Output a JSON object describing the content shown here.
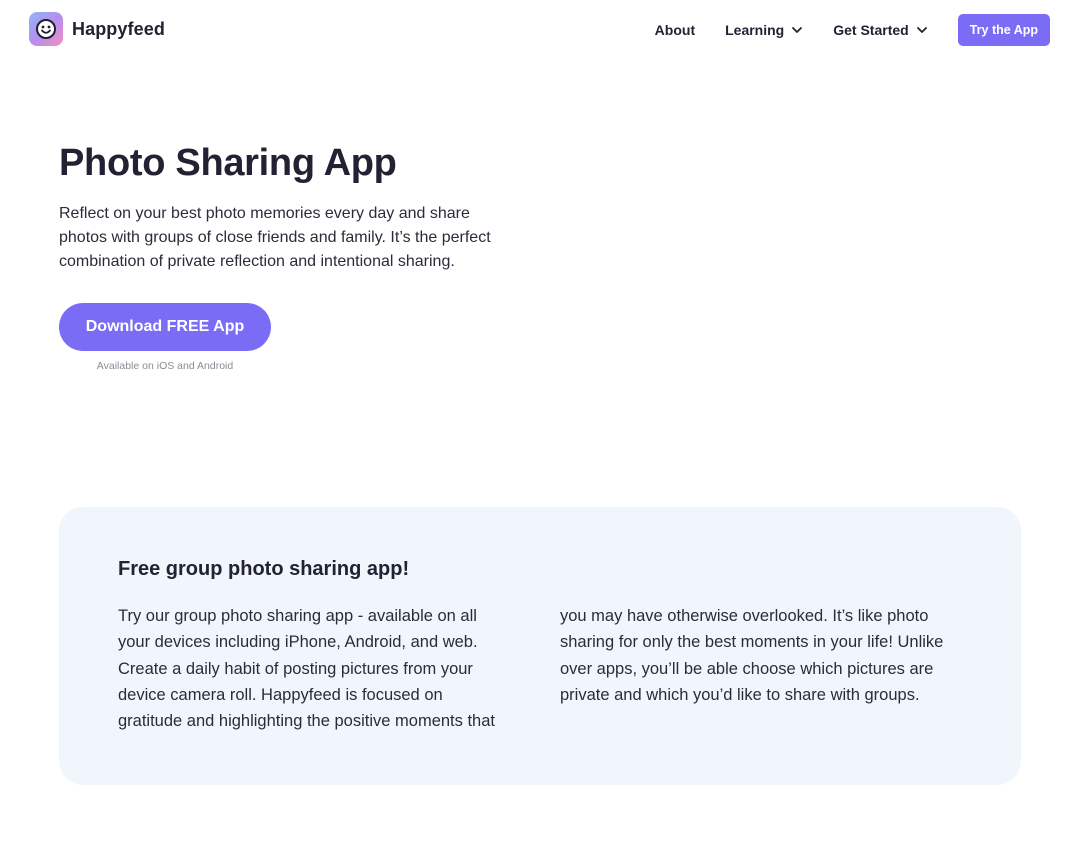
{
  "nav": {
    "brand": "Happyfeed",
    "links": [
      {
        "label": "About",
        "dropdown": false
      },
      {
        "label": "Learning",
        "dropdown": true
      },
      {
        "label": "Get Started",
        "dropdown": true
      }
    ],
    "cta": "Try the App"
  },
  "hero": {
    "title": "Photo Sharing App",
    "description": "Reflect on your best photo memories every day and share photos with groups of close friends and family. It’s the perfect combination of private reflection and intentional sharing.",
    "button": "Download FREE App",
    "note": "Available on iOS and Android"
  },
  "feature": {
    "title": "Free group photo sharing app!",
    "text": "Try our group photo sharing app - available on all your devices including iPhone, Android, and web. Create a daily habit of posting pictures from your device camera roll. Happyfeed is focused on gratitude and highlighting the positive moments that you may have otherwise overlooked. It’s like photo sharing for only the best moments in your life! Unlike over apps, you’ll be able choose which pictures are private and which you’d like to share with groups."
  },
  "colors": {
    "accent": "#7b6cf6",
    "card_background": "#f1f6fd",
    "text": "#222233"
  },
  "icons": [
    "happyfeed-logo-icon",
    "chevron-down-icon"
  ]
}
